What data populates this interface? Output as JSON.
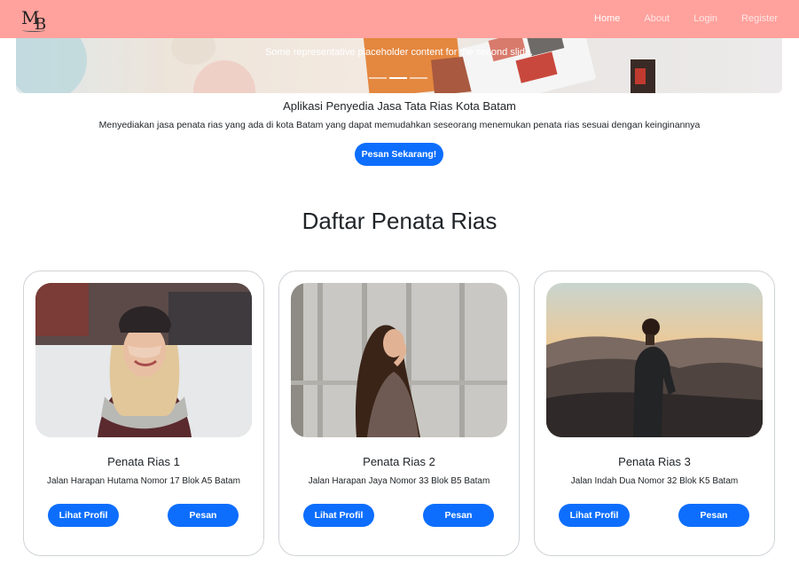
{
  "navbar": {
    "brand": "MB",
    "links": [
      {
        "label": "Home",
        "active": true
      },
      {
        "label": "About",
        "active": false
      },
      {
        "label": "Login",
        "active": false
      },
      {
        "label": "Register",
        "active": false
      }
    ],
    "color": "#ffa19c"
  },
  "hero": {
    "caption": "Some representative placeholder content for the second slide.",
    "active_slide": 2,
    "slide_count": 3
  },
  "intro": {
    "tagline": "Aplikasi Penyedia Jasa Tata Rias Kota Batam",
    "description": "Menyediakan jasa penata rias yang ada di kota Batam yang dapat memudahkan seseorang menemukan penata rias sesuai dengan keinginannya",
    "cta": "Pesan Sekarang!"
  },
  "section_title": "Daftar Penata Rias",
  "cards": [
    {
      "name": "Penata Rias 1",
      "address": "Jalan Harapan Hutama Nomor 17 Blok A5 Batam",
      "profile_label": "Lihat Profil",
      "order_label": "Pesan"
    },
    {
      "name": "Penata Rias 2",
      "address": "Jalan Harapan Jaya Nomor 33 Blok B5 Batam",
      "profile_label": "Lihat Profil",
      "order_label": "Pesan"
    },
    {
      "name": "Penata Rias 3",
      "address": "Jalan Indah Dua Nomor 32 Blok K5 Batam",
      "profile_label": "Lihat Profil",
      "order_label": "Pesan"
    }
  ],
  "accent_color": "#0d6efd"
}
